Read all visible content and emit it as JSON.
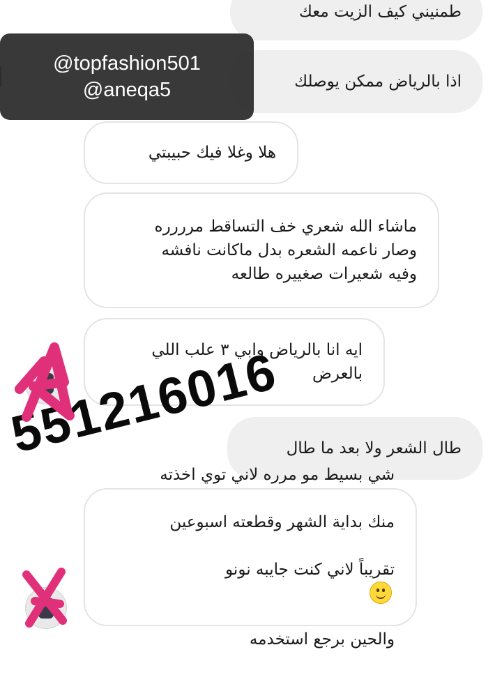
{
  "messages": [
    {
      "id": "m1",
      "type": "out",
      "text": "طمنيني كيف الزيت معك"
    },
    {
      "id": "m2",
      "type": "out",
      "text": "اذا بالرياض ممكن يوصلك"
    },
    {
      "id": "m3",
      "type": "in",
      "text": "هلا وغلا فيك حبيبتي"
    },
    {
      "id": "m4",
      "type": "in",
      "text": "ماشاء الله شعري خف التساقط مرررره\nوصار ناعمه الشعره بدل ماكانت نافشه\nوفيه شعيرات صغييره طالعه"
    },
    {
      "id": "m5",
      "type": "in",
      "text": "ايه انا بالرياض وابي ٣ علب اللي\nبالعرض"
    },
    {
      "id": "m6",
      "type": "out",
      "text": "طال الشعر ولا بعد ما طال"
    },
    {
      "id": "m7",
      "type": "in",
      "line1": "شي بسيط مو مرره لاني توي اخذته",
      "line2": "منك بداية الشهر وقطعته اسبوعين",
      "line3": "تقريباً لاني كنت جايبه نونو",
      "line4": "والحين برجع استخدمه"
    }
  ],
  "overlay": {
    "handles": [
      "@topfashion501",
      "@aneqa5"
    ],
    "phone": "551216016",
    "scribble_color": "#e0307a"
  }
}
